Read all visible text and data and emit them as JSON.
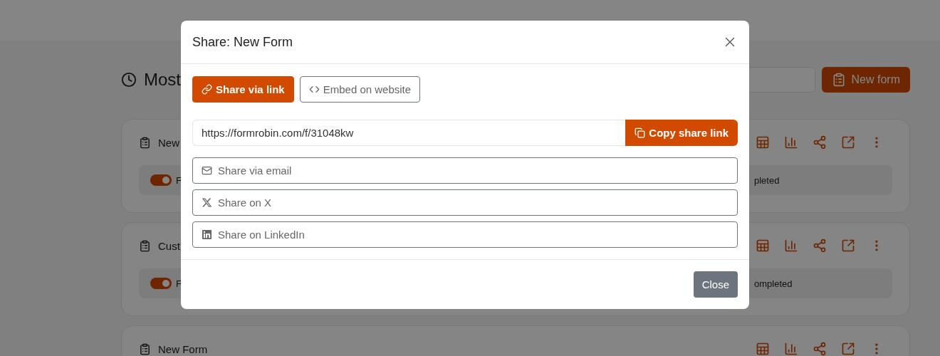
{
  "page": {
    "heading": "Most",
    "new_form_button": "New form"
  },
  "forms": [
    {
      "title": "New",
      "toggle": {
        "label": "F",
        "on": true
      },
      "status": "pleted"
    },
    {
      "title": "Cust",
      "toggle": {
        "label": "F",
        "on": true
      },
      "status": "ompleted"
    },
    {
      "title": "New Form"
    }
  ],
  "dialog": {
    "title": "Share: New Form",
    "tabs": [
      {
        "label": "Share via link",
        "selected": true
      },
      {
        "label": "Embed on website",
        "selected": false
      }
    ],
    "link_field": {
      "value": "https://formrobin.com/f/31048kw"
    },
    "copy_button": "Copy share link",
    "share_options": [
      {
        "kind": "email",
        "label": "Share via email"
      },
      {
        "kind": "x",
        "label": "Share on X"
      },
      {
        "kind": "linkedin",
        "label": "Share on LinkedIn"
      }
    ],
    "close_button": "Close"
  }
}
